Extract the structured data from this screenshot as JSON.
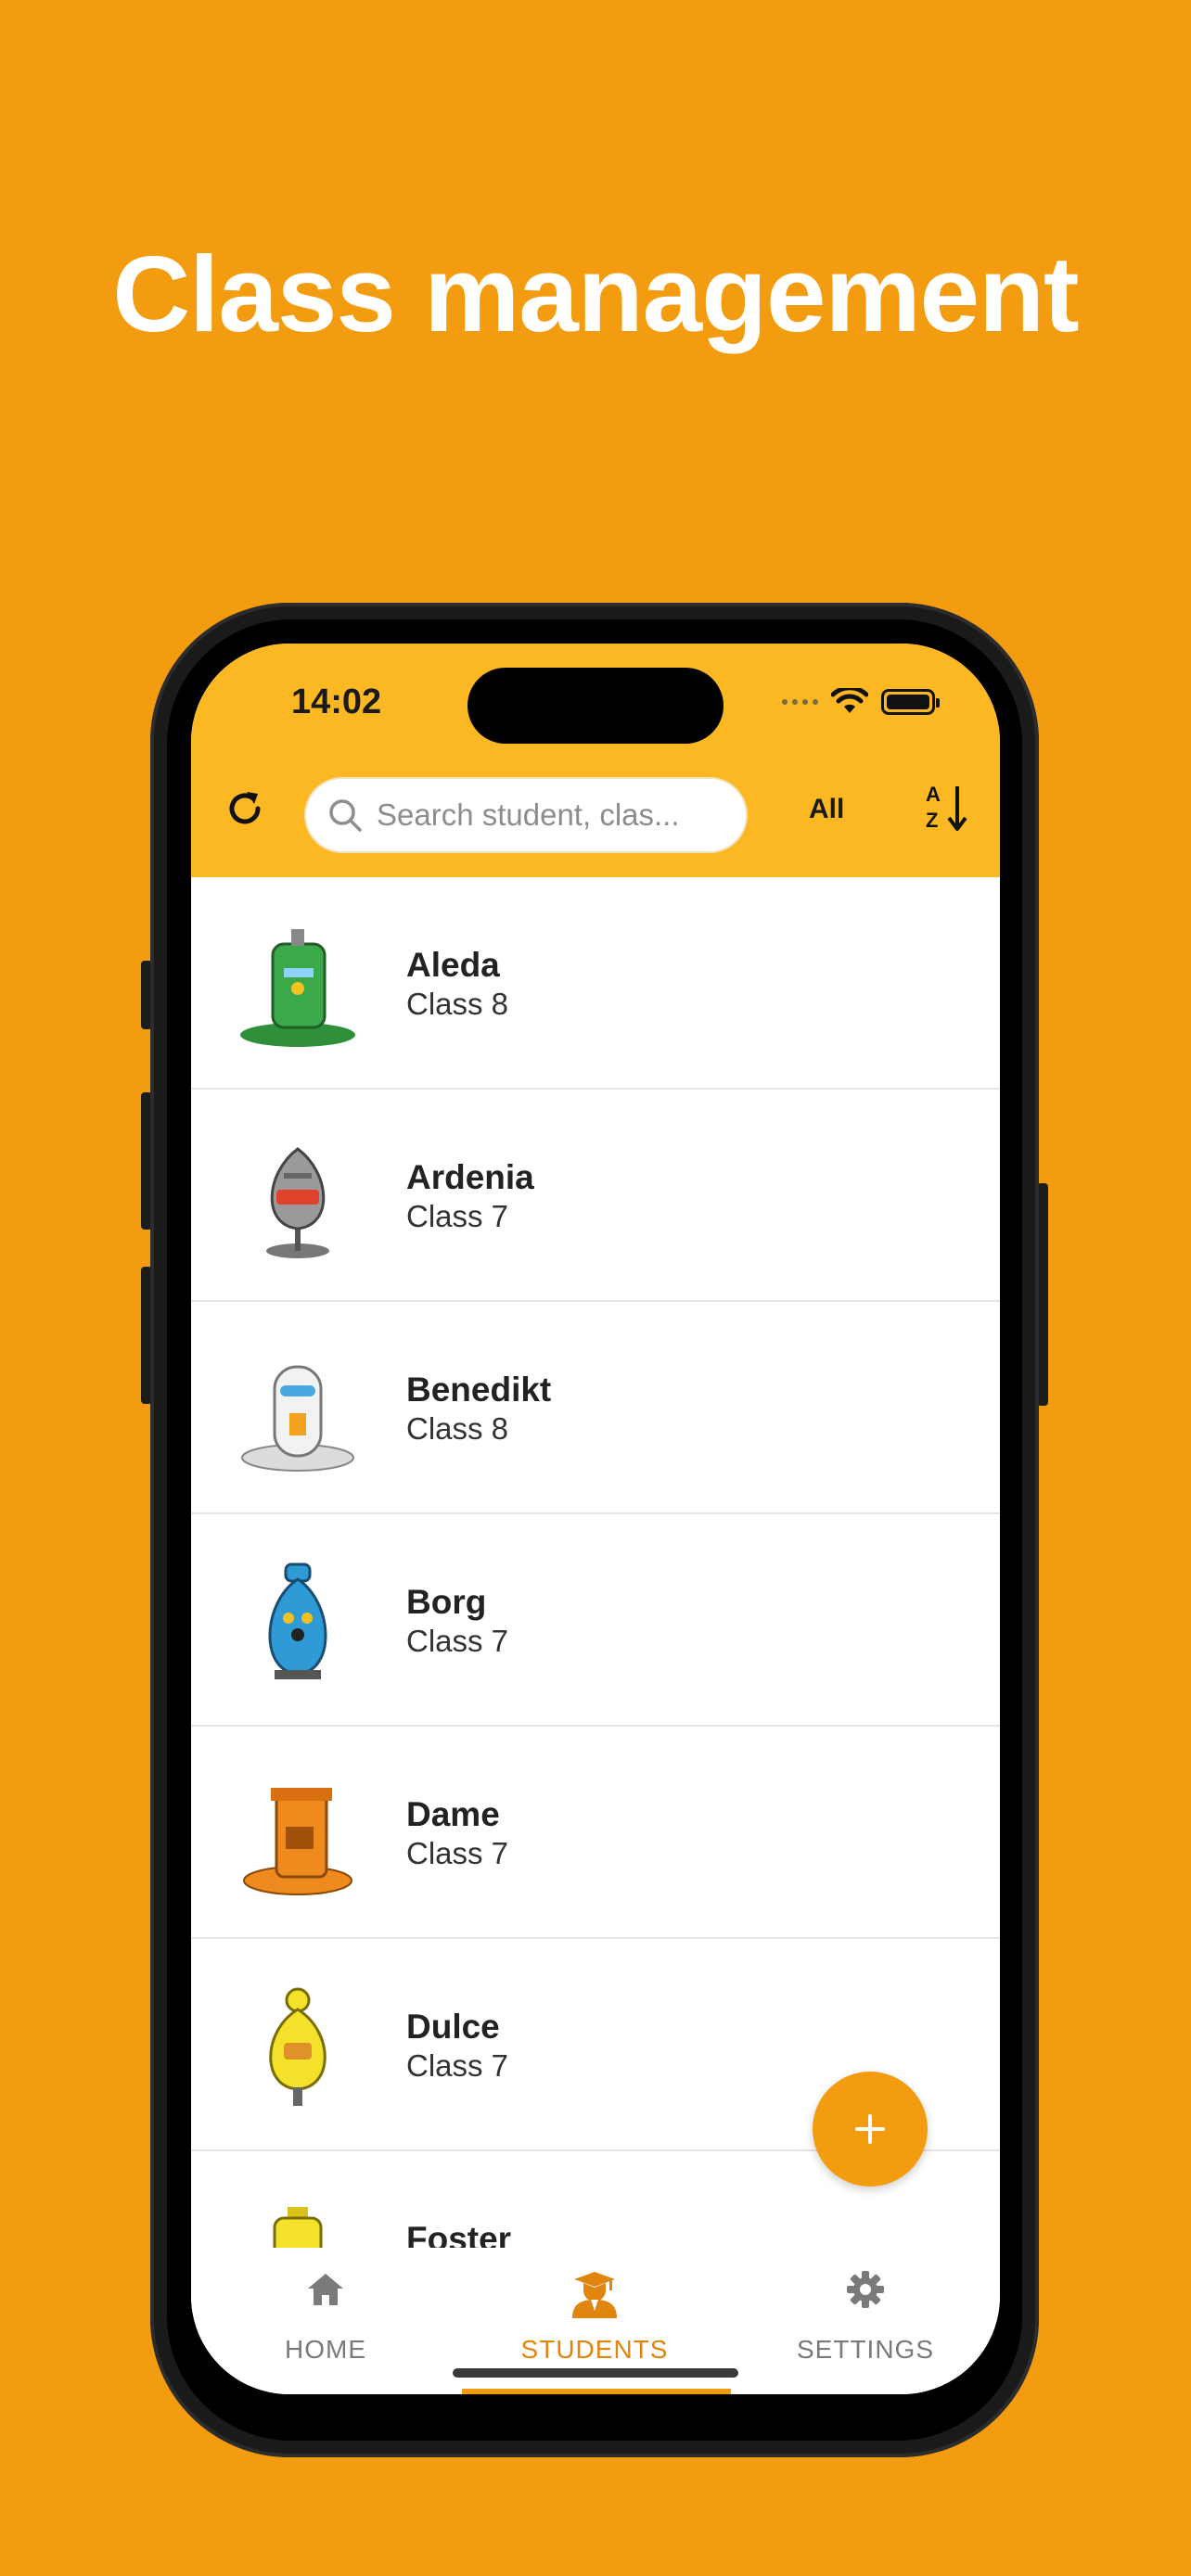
{
  "headline": "Class management",
  "status_bar": {
    "time": "14:02"
  },
  "toolbar": {
    "search_placeholder": "Search student, clas...",
    "filter_label": "All"
  },
  "students": [
    {
      "name": "Aleda",
      "class": "Class 8",
      "avatar_color": "#3BA84A"
    },
    {
      "name": "Ardenia",
      "class": "Class 7",
      "avatar_color": "#9A9A9A"
    },
    {
      "name": "Benedikt",
      "class": "Class 8",
      "avatar_color": "#E8E8E8"
    },
    {
      "name": "Borg",
      "class": "Class 7",
      "avatar_color": "#2E9BD6"
    },
    {
      "name": "Dame",
      "class": "Class 7",
      "avatar_color": "#EE8A1E"
    },
    {
      "name": "Dulce",
      "class": "Class 7",
      "avatar_color": "#F3E12A"
    },
    {
      "name": "Foster",
      "class": "",
      "avatar_color": "#F3E12A"
    }
  ],
  "tabs": [
    {
      "label": "HOME",
      "icon": "home-icon"
    },
    {
      "label": "STUDENTS",
      "icon": "student-icon",
      "active": true
    },
    {
      "label": "SETTINGS",
      "icon": "gear-icon"
    }
  ],
  "colors": {
    "background": "#F39C0F",
    "topbar": "#FCB823",
    "accent": "#E0850E"
  }
}
